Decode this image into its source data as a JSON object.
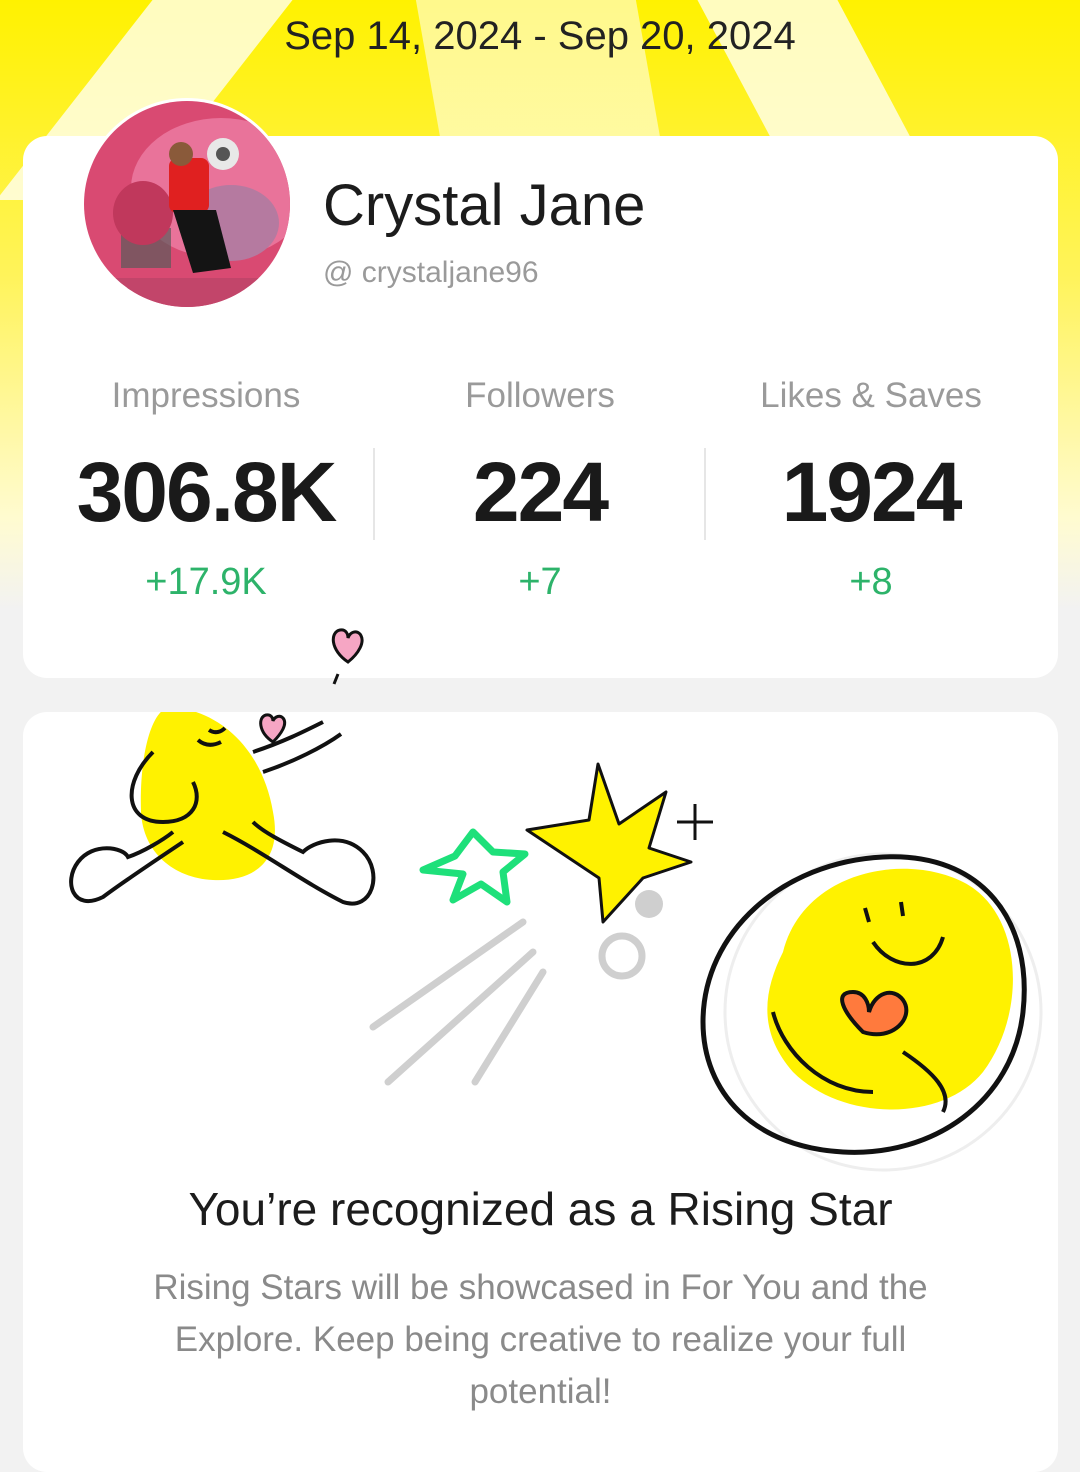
{
  "header": {
    "date_range": "Sep 14, 2024 - Sep 20, 2024"
  },
  "profile": {
    "name": "Crystal Jane",
    "handle": "@ crystaljane96",
    "avatar_icon": "profile-photo"
  },
  "stats": [
    {
      "label": "Impressions",
      "value": "306.8K",
      "delta": "+17.9K"
    },
    {
      "label": "Followers",
      "value": "224",
      "delta": "+7"
    },
    {
      "label": "Likes & Saves",
      "value": "1924",
      "delta": "+8"
    }
  ],
  "recognition": {
    "title": "You’re recognized as a Rising Star",
    "description": "Rising Stars will be showcased in For You and the Explore. Keep being creative to realize your full potential!"
  },
  "colors": {
    "accent_yellow": "#fff200",
    "delta_green": "#2db36a",
    "star_green": "#1ee07a"
  }
}
